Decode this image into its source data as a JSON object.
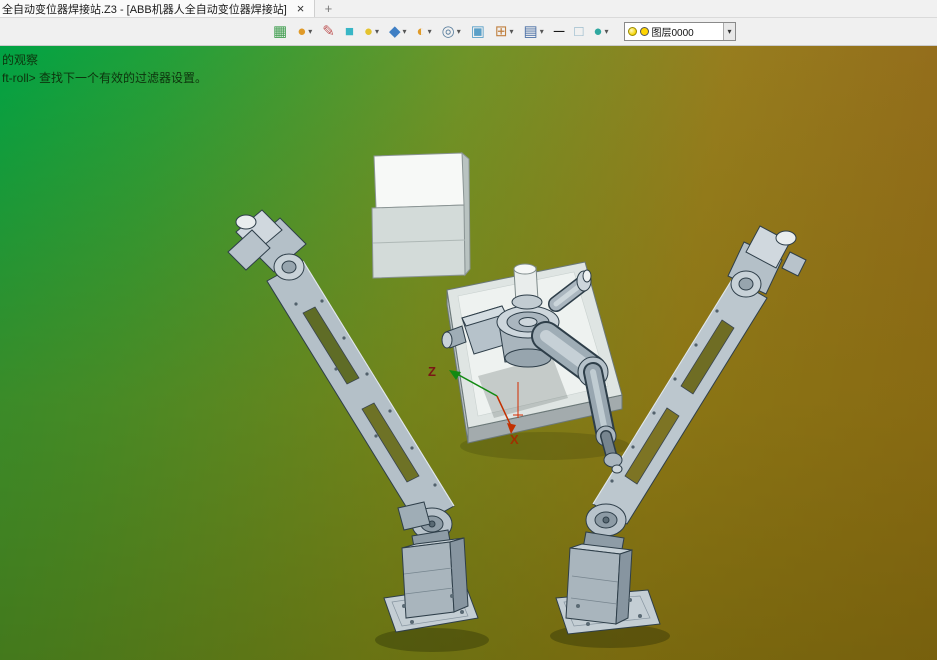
{
  "window": {
    "tab_title": "全自动变位器焊接站.Z3 - [ABB机器人全自动变位器焊接站]",
    "close_glyph": "×",
    "new_tab_glyph": "+"
  },
  "toolbar": {
    "caret_glyph": "▾",
    "icons": [
      {
        "name": "view-image-icon",
        "glyph": "▦",
        "color": "#3f9e4e",
        "caret": false
      },
      {
        "name": "render-mode-icon",
        "glyph": "●",
        "color": "#e09a28",
        "caret": true
      },
      {
        "name": "paint-color-icon",
        "glyph": "✎",
        "color": "#c05a5a",
        "caret": false
      },
      {
        "name": "wireframe-cube-icon",
        "glyph": "■",
        "color": "#38b6c6",
        "caret": false
      },
      {
        "name": "shaded-sphere-icon",
        "glyph": "●",
        "color": "#e4c32e",
        "caret": true
      },
      {
        "name": "view-orientation-icon",
        "glyph": "◆",
        "color": "#3f7fc4",
        "caret": true
      },
      {
        "name": "section-view-icon",
        "glyph": "◐",
        "color": "#e09a28",
        "caret": true
      },
      {
        "name": "zoom-icon",
        "glyph": "◎",
        "color": "#5b7f9e",
        "caret": true
      },
      {
        "name": "screen-capture-icon",
        "glyph": "▣",
        "color": "#5aa0c8",
        "caret": false
      },
      {
        "name": "grid-snap-icon",
        "glyph": "⊞",
        "color": "#c08040",
        "caret": true
      },
      {
        "name": "display-monitor-icon",
        "glyph": "▤",
        "color": "#4a6fa5",
        "caret": true
      },
      {
        "name": "line-width-icon",
        "glyph": "─",
        "color": "#111111",
        "caret": false
      },
      {
        "name": "background-swatch-icon",
        "glyph": "□",
        "color": "#8fb4c8",
        "caret": false
      },
      {
        "name": "earth-render-icon",
        "glyph": "●",
        "color": "#2fa8a0",
        "caret": true
      }
    ],
    "layer_combo": {
      "value": "图层0000",
      "bulb_icon": "layer-visibility-bulb-icon",
      "swatch_icon": "layer-color-swatch"
    }
  },
  "viewport": {
    "messages": {
      "line1": "的观察",
      "line2": "ft-roll> 查找下一个有效的过滤器设置。"
    },
    "axis": {
      "z": "Z",
      "x": "X"
    }
  },
  "colors": {
    "bg_green": "#00a344",
    "bg_orange": "#92661a",
    "bg_olive": "#6e6a14",
    "metal_light": "#cdd6dc",
    "metal_mid": "#aab6bf",
    "metal_dark": "#8795a0",
    "outline": "#2e3e49"
  }
}
